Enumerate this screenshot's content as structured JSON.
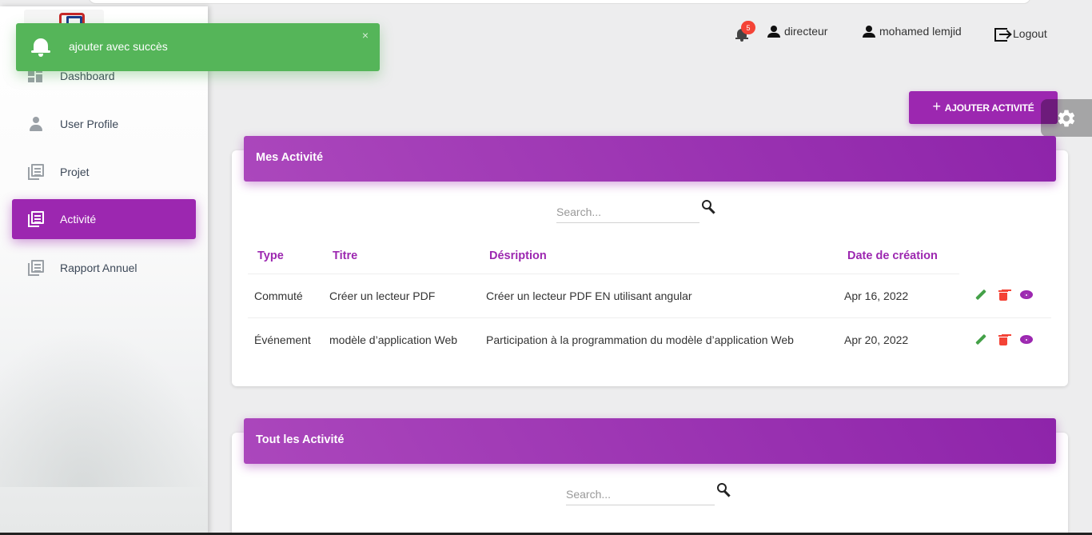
{
  "toast": {
    "message": "ajouter avec succès",
    "close": "×",
    "color": "#55b559"
  },
  "sidebar": {
    "items": [
      {
        "label": "Dashboard",
        "icon": "dashboard-icon",
        "active": false
      },
      {
        "label": "User Profile",
        "icon": "person-icon",
        "active": false
      },
      {
        "label": "Projet",
        "icon": "library-books-icon",
        "active": false
      },
      {
        "label": "Activité",
        "icon": "library-books-icon",
        "active": true
      },
      {
        "label": "Rapport Annuel",
        "icon": "library-books-icon",
        "active": false
      }
    ]
  },
  "header": {
    "notifications_count": "5",
    "role": "directeur",
    "user_name": "mohamed lemjid",
    "logout_label": "Logout"
  },
  "add_button": {
    "label": "AJOUTER ACTIVITÉ",
    "icon": "plus-icon"
  },
  "colors": {
    "primary": "#9c27b0",
    "success": "#4caf50",
    "danger": "#f44336"
  },
  "mes_activites": {
    "title": "Mes Activité",
    "search_placeholder": "Search...",
    "columns": [
      "Type",
      "Titre",
      "Désription",
      "Date de création"
    ],
    "rows": [
      {
        "type": "Commuté",
        "titre": "Créer un lecteur PDF",
        "description": "Créer un lecteur PDF EN utilisant angular",
        "date": "Apr 16, 2022"
      },
      {
        "type": "Événement",
        "titre": "modèle d’application Web",
        "description": "Participation à la programmation du modèle d’application Web",
        "date": "Apr 20, 2022"
      }
    ]
  },
  "tout_activites": {
    "title": "Tout les Activité",
    "search_placeholder": "Search..."
  }
}
